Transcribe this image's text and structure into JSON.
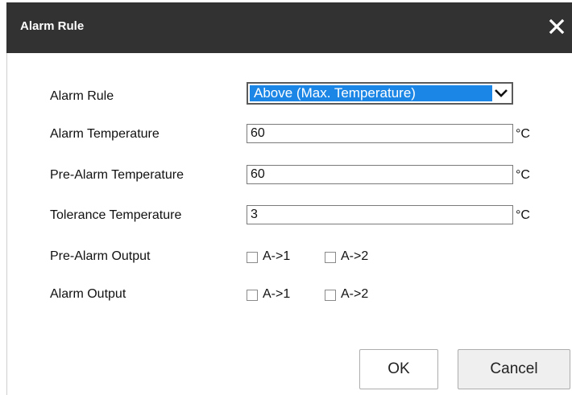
{
  "dialog": {
    "title": "Alarm Rule",
    "close_icon": "close-icon"
  },
  "form": {
    "alarm_rule": {
      "label": "Alarm Rule",
      "selected": "Above (Max. Temperature)"
    },
    "alarm_temperature": {
      "label": "Alarm Temperature",
      "value": "60",
      "unit": "°C"
    },
    "pre_alarm_temperature": {
      "label": "Pre-Alarm Temperature",
      "value": "60",
      "unit": "°C"
    },
    "tolerance_temperature": {
      "label": "Tolerance Temperature",
      "value": "3",
      "unit": "°C"
    },
    "pre_alarm_output": {
      "label": "Pre-Alarm Output",
      "options": [
        {
          "label": "A->1",
          "checked": false
        },
        {
          "label": "A->2",
          "checked": false
        }
      ]
    },
    "alarm_output": {
      "label": "Alarm Output",
      "options": [
        {
          "label": "A->1",
          "checked": false
        },
        {
          "label": "A->2",
          "checked": false
        }
      ]
    }
  },
  "buttons": {
    "ok": "OK",
    "cancel": "Cancel"
  },
  "colors": {
    "title_bar": "#323232",
    "selection": "#1c86e6"
  }
}
